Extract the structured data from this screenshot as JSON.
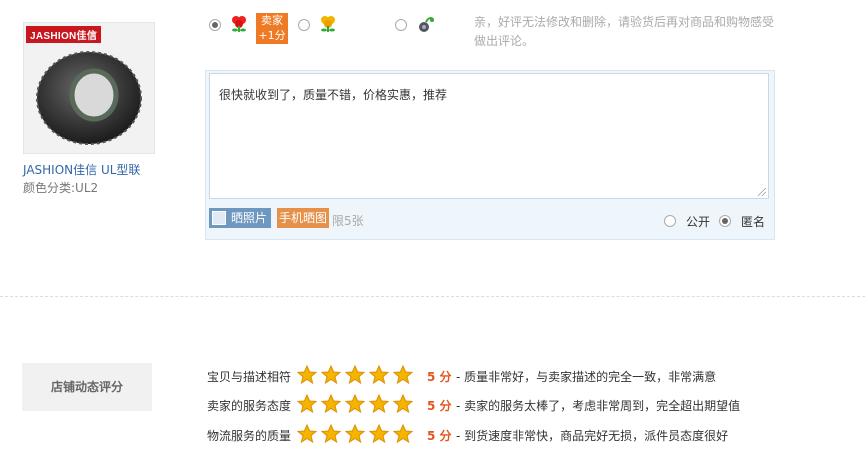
{
  "product": {
    "brand_badge": "JASHION佳信",
    "name": "JASHION佳信 UL型联",
    "sku": "颜色分类:UL2"
  },
  "rating": {
    "seller_bonus_line1": "卖家",
    "seller_bonus_line2": "+1分",
    "notice": "亲，好评无法修改和删除，请验货后再对商品和购物感受做出评论。",
    "icons": [
      "rose-good-icon",
      "flower-neutral-icon",
      "wilted-bad-icon"
    ],
    "selected": "good"
  },
  "review": {
    "text": "很快就收到了，质量不错，价格实惠，推荐",
    "photo_button": "晒照片",
    "mobile_button": "手机晒图",
    "limit": "限5张",
    "public_label": "公开",
    "anonymous_label": "匿名",
    "selected_visibility": "anonymous"
  },
  "shop_rating": {
    "title": "店铺动态评分",
    "rows": [
      {
        "label": "宝贝与描述相符",
        "stars": 5,
        "score": "5 分",
        "desc": "- 质量非常好，与卖家描述的完全一致，非常满意"
      },
      {
        "label": "卖家的服务态度",
        "stars": 5,
        "score": "5 分",
        "desc": "- 卖家的服务太棒了，考虑非常周到，完全超出期望值"
      },
      {
        "label": "物流服务的质量",
        "stars": 5,
        "score": "5 分",
        "desc": "- 到货速度非常快，商品完好无损，派件员态度很好"
      }
    ]
  },
  "colors": {
    "accent": "#e4551c",
    "badge": "#ef7a25",
    "star": "#f5b400",
    "link": "#3366aa"
  }
}
